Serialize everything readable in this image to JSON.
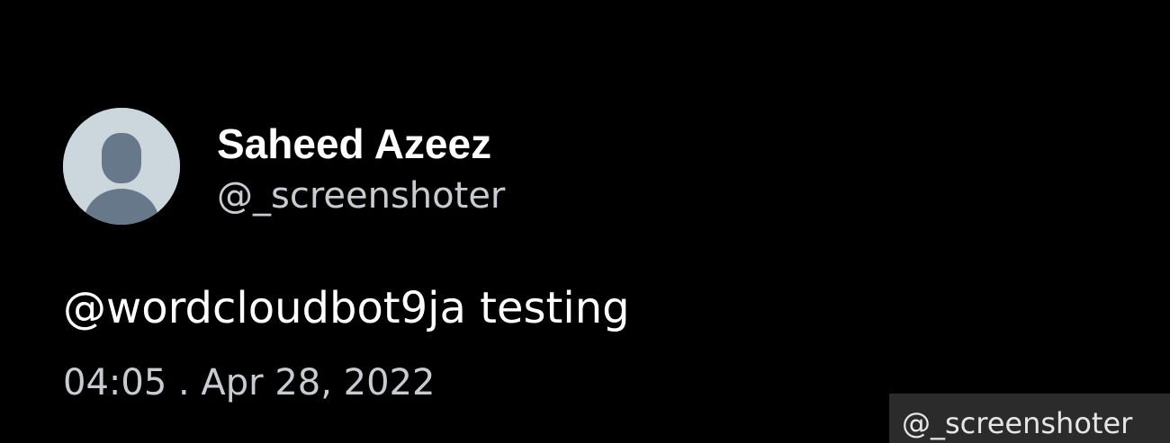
{
  "tweet": {
    "display_name": "Saheed Azeez",
    "handle": "@_screenshoter",
    "text": "@wordcloudbot9ja testing",
    "timestamp": "04:05 . Apr 28, 2022",
    "avatar_icon": "default-profile-icon"
  },
  "watermark": {
    "text": "@_screenshoter"
  },
  "colors": {
    "background": "#000000",
    "name_text": "#ffffff",
    "secondary_text": "#c8ccd0",
    "avatar_background": "#ccd6dd",
    "avatar_silhouette": "#66788a",
    "watermark_background": "#2b2b2b"
  }
}
